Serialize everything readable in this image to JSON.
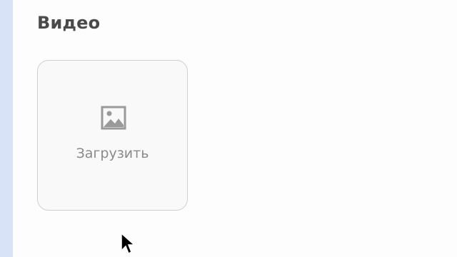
{
  "section": {
    "title": "Видео"
  },
  "upload": {
    "label": "Загрузить",
    "icon": "image-icon"
  },
  "colors": {
    "accent_strip": "#d9e3f8",
    "title_text": "#4a4a4a",
    "tile_border": "#cfcfcf",
    "tile_background": "#f9f9f9",
    "icon_and_label": "#8a8a8a"
  }
}
